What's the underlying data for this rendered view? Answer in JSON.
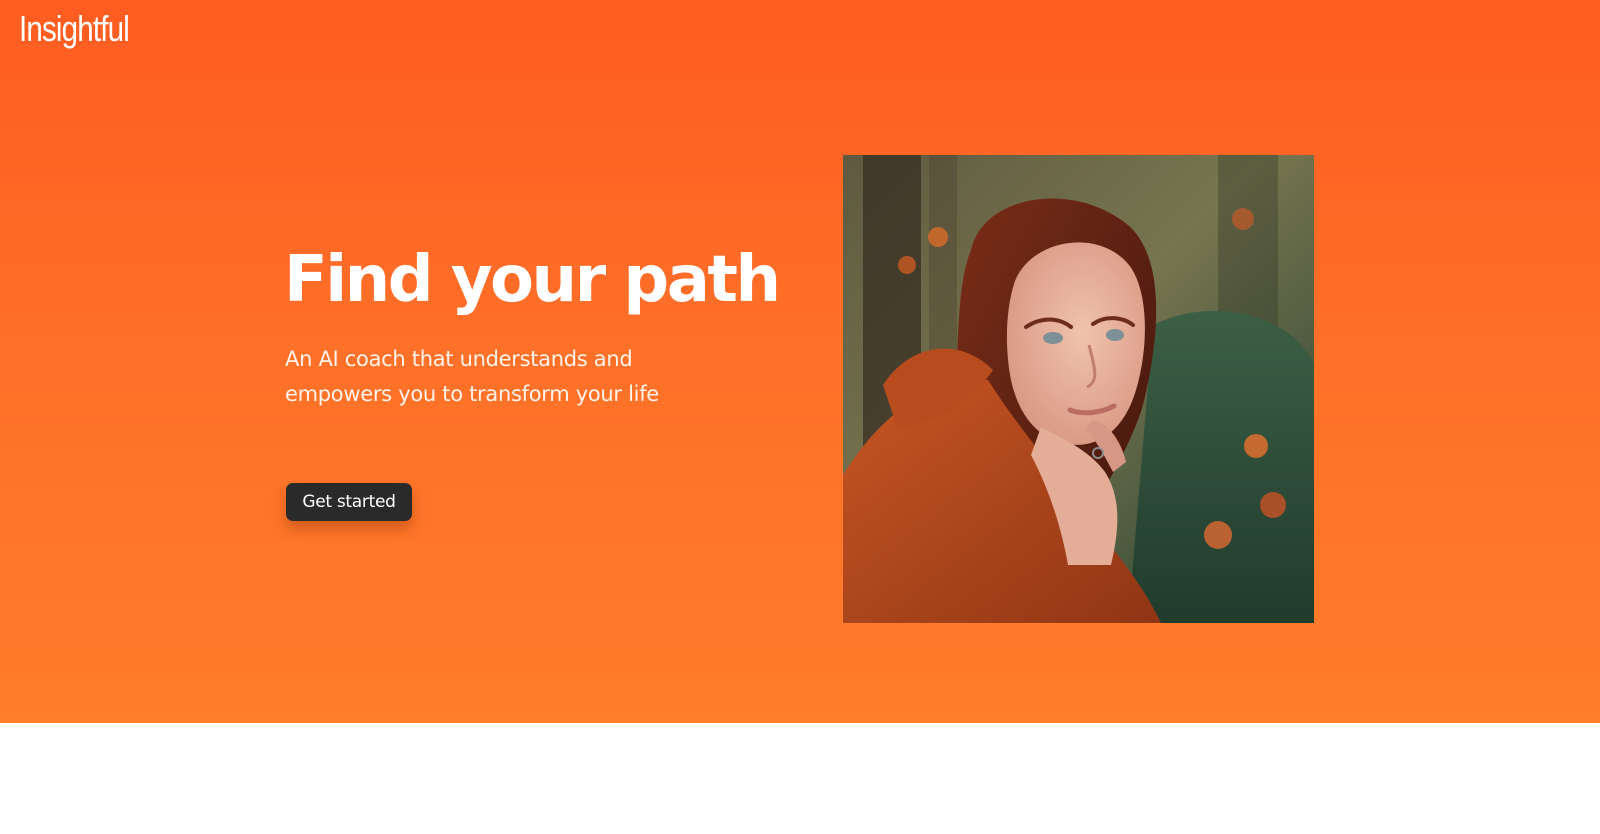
{
  "brand": {
    "name": "Insightful"
  },
  "hero": {
    "headline": "Find your path",
    "subtitle": "An AI coach that understands and empowers you to transform your life",
    "cta_label": "Get started"
  },
  "colors": {
    "hero_gradient_top": "#ff5c21",
    "hero_gradient_bottom": "#ff7d2b",
    "button_background": "#2b2a2a",
    "text": "#ffffff"
  },
  "icons": {
    "hero_image": "woman-in-forest-photo"
  }
}
